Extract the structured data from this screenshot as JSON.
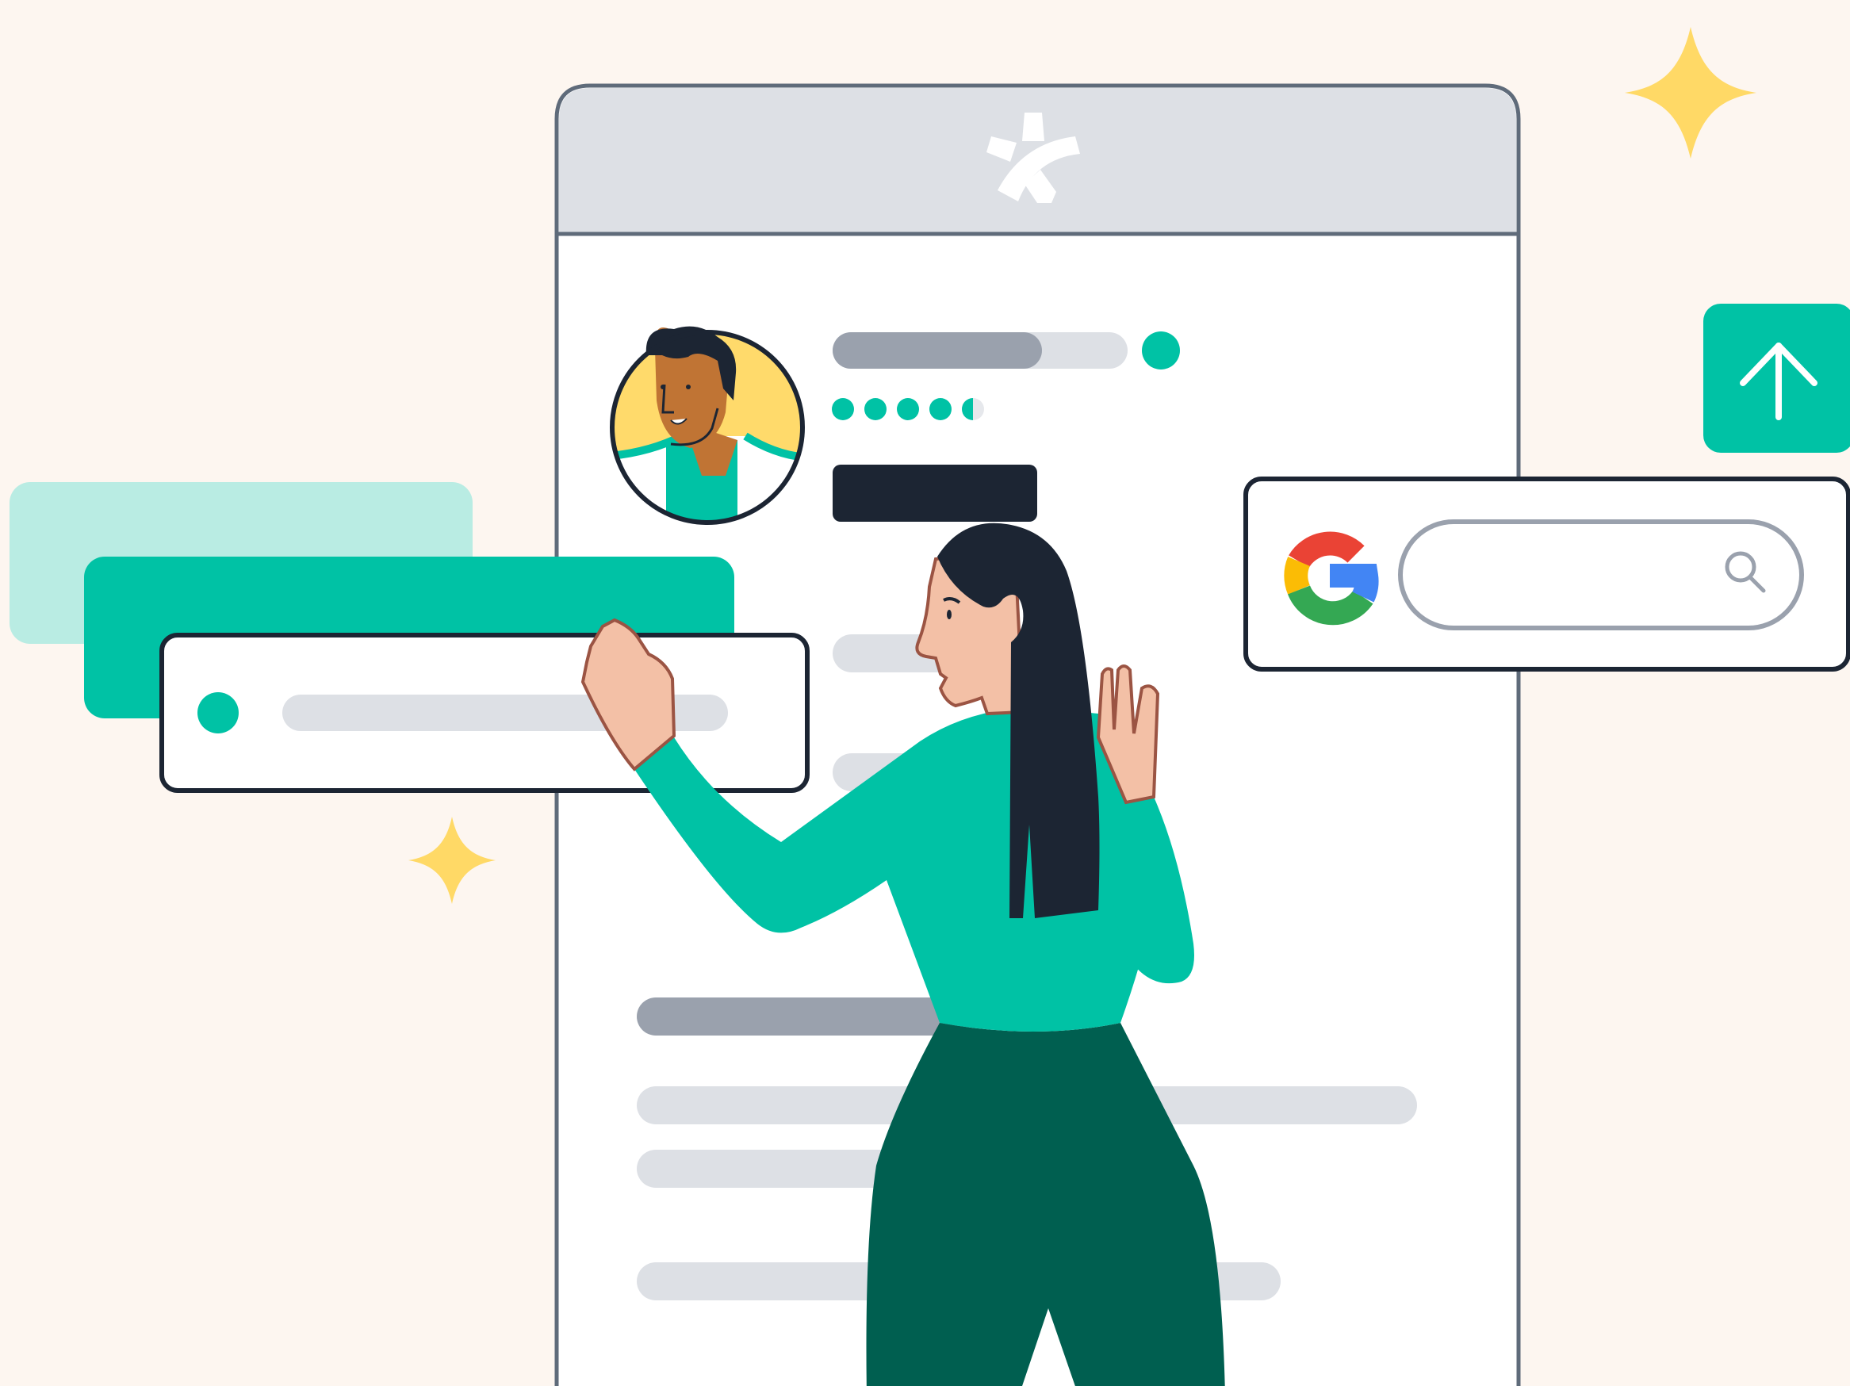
{
  "colors": {
    "background": "#fdf6f0",
    "accent_teal": "#00c2a5",
    "accent_teal_light": "#b9ece3",
    "dark_green": "#005f50",
    "navy": "#1c2533",
    "frame_gray": "#5f6b7a",
    "header_gray": "#dde0e5",
    "bar_dark_gray": "#9aa1ad",
    "bar_light_gray": "#dde0e5",
    "sparkle_yellow": "#ffd966",
    "skin_light": "#f3c0a6",
    "skin_dark": "#c07434",
    "avatar_bg": "#ffda6b",
    "google_blue": "#4285f4",
    "google_red": "#ea4335",
    "google_yellow": "#fbbc05",
    "google_green": "#34a853"
  },
  "icons": {
    "app_logo": "sunburst-logo-icon",
    "upload": "upload-arrow-icon",
    "search_engine": "google-g-icon",
    "search": "search-icon",
    "rating": "star-dots-icon",
    "sparkles": "sparkle-icon"
  },
  "profile": {
    "rating": 4.5,
    "rating_max": 5,
    "status": "online",
    "progress": 0.7
  }
}
